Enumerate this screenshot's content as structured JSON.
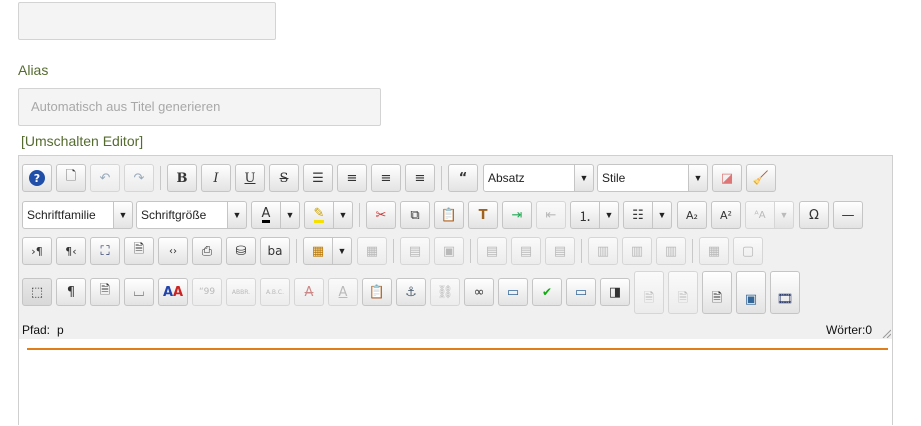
{
  "title_field": {
    "value": ""
  },
  "alias": {
    "label": "Alias",
    "placeholder": "Automatisch aus Titel generieren"
  },
  "toggle_editor": "[Umschalten Editor]",
  "toolbar": {
    "format_select": "Absatz",
    "styles_select": "Stile",
    "font_family_select": "Schriftfamilie",
    "font_size_select": "Schriftgröße"
  },
  "status": {
    "path_label": "Pfad:",
    "path_value": "p",
    "word_count": "Wörter:0"
  },
  "colors": {
    "accent_line": "#e07e1a",
    "label_green": "#556b2f"
  },
  "icons": {
    "row1": [
      "help-icon",
      "new-document-icon",
      "undo-icon",
      "redo-icon",
      "bold-icon",
      "italic-icon",
      "underline-icon",
      "strikethrough-icon",
      "justify-icon",
      "align-center-icon",
      "align-left-icon",
      "align-right-icon",
      "blockquote-icon",
      "eraser-icon",
      "cleanup-broom-icon"
    ],
    "row2": [
      "cut-icon",
      "copy-icon",
      "paste-icon",
      "paste-text-icon",
      "indent-icon",
      "outdent-icon",
      "numbered-list-icon",
      "bullet-list-icon",
      "subscript-icon",
      "superscript-icon",
      "font-size-icon",
      "special-char-icon",
      "horizontal-rule-icon"
    ],
    "row3": [
      "ltr-icon",
      "rtl-icon",
      "fullscreen-icon",
      "template-icon",
      "source-code-icon",
      "print-icon",
      "search-icon",
      "replace-icon",
      "table-icon",
      "delete-table-icon",
      "table-row-props-icon",
      "table-cell-props-icon",
      "insert-row-before-icon",
      "insert-row-after-icon",
      "delete-row-icon",
      "insert-col-before-icon",
      "insert-col-after-icon",
      "delete-col-icon",
      "split-cells-icon",
      "merge-cells-icon"
    ],
    "row4": [
      "visual-aid-icon",
      "show-blocks-icon",
      "insert-file-icon",
      "nonbreaking-icon",
      "style-props-icon",
      "cite-icon",
      "abbr-icon",
      "acronym-icon",
      "del-icon",
      "ins-icon",
      "paste-word-icon",
      "anchor-icon",
      "unlink-icon",
      "link-icon",
      "image-icon",
      "spellcheck-icon",
      "layer-icon",
      "layer-abs-icon",
      "article-icon",
      "pagebreak-icon",
      "readmore-icon",
      "media-icon",
      "video-icon"
    ]
  }
}
